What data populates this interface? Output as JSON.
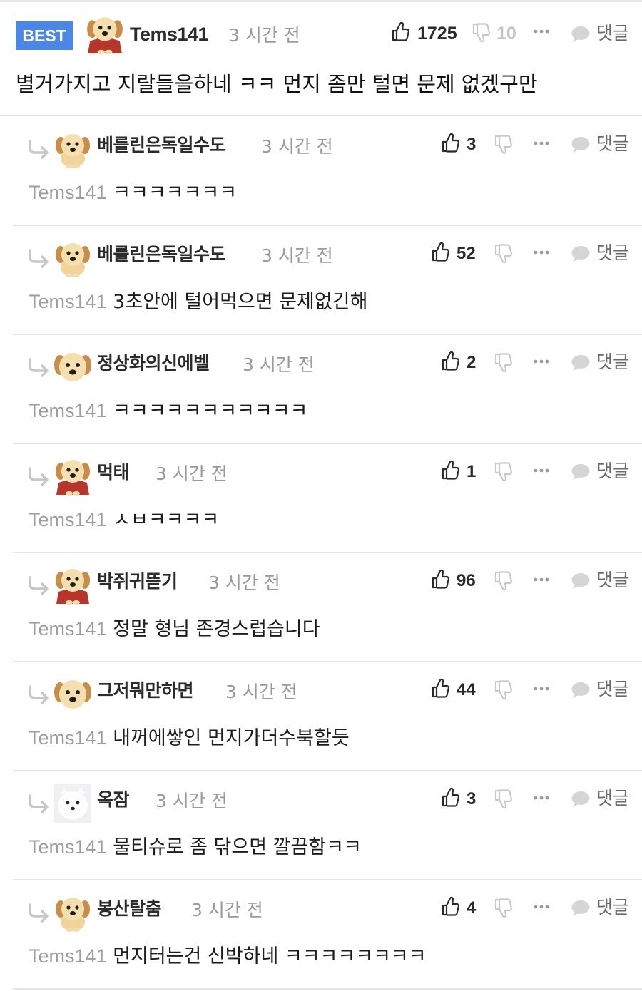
{
  "best": {
    "badge": "BEST",
    "user": "Tems141",
    "time": "3 시간 전",
    "likes": "1725",
    "dislikes": "10",
    "reply_label": "댓글",
    "text": "별거가지고 지랄들을하네 ㅋㅋ 먼지 좀만 털면 문제 없겠구만"
  },
  "replies": [
    {
      "user": "베를린은독일수도",
      "time": "3 시간 전",
      "likes": "3",
      "reply_label": "댓글",
      "mention": "Tems141",
      "text": "ㅋㅋㅋㅋㅋㅋㅋ",
      "avatar": "puppy"
    },
    {
      "user": "베를린은독일수도",
      "time": "3 시간 전",
      "likes": "52",
      "reply_label": "댓글",
      "mention": "Tems141",
      "text": "3초안에 털어먹으면 문제없긴해",
      "avatar": "puppy"
    },
    {
      "user": "정상화의신에벨",
      "time": "3 시간 전",
      "likes": "2",
      "reply_label": "댓글",
      "mention": "Tems141",
      "text": "ㅋㅋㅋㅋㅋㅋㅋㅋㅋㅋㅋ",
      "avatar": "puppy-face"
    },
    {
      "user": "먹태",
      "time": "3 시간 전",
      "likes": "1",
      "reply_label": "댓글",
      "mention": "Tems141",
      "text": "ㅅㅂㅋㅋㅋㅋ",
      "avatar": "puppy-cape"
    },
    {
      "user": "박쥐귀뜯기",
      "time": "3 시간 전",
      "likes": "96",
      "reply_label": "댓글",
      "mention": "Tems141",
      "text": "정말 형님 존경스럽습니다",
      "avatar": "puppy-cape"
    },
    {
      "user": "그저뭐만하면",
      "time": "3 시간 전",
      "likes": "44",
      "reply_label": "댓글",
      "mention": "Tems141",
      "text": "내꺼에쌓인 먼지가더수북할듯",
      "avatar": "puppy-face"
    },
    {
      "user": "옥잠",
      "time": "3 시간 전",
      "likes": "3",
      "reply_label": "댓글",
      "mention": "Tems141",
      "text": "물티슈로 좀 닦으면 깔끔함ㅋㅋ",
      "avatar": "white-dog"
    },
    {
      "user": "봉산탈춤",
      "time": "3 시간 전",
      "likes": "4",
      "reply_label": "댓글",
      "mention": "Tems141",
      "text": "먼지터는건 신박하네 ㅋㅋㅋㅋㅋㅋㅋㅋ",
      "avatar": "puppy"
    }
  ],
  "icons": {
    "thumbs_up": "thumbs-up-icon",
    "thumbs_down": "thumbs-down-icon",
    "more": "more-dots-icon",
    "reply": "speech-bubble-icon",
    "reply_arrow": "reply-arrow-icon"
  },
  "colors": {
    "best_badge": "#4d87e6",
    "mention": "#9d9d9d",
    "muted": "#9a9a9a"
  }
}
